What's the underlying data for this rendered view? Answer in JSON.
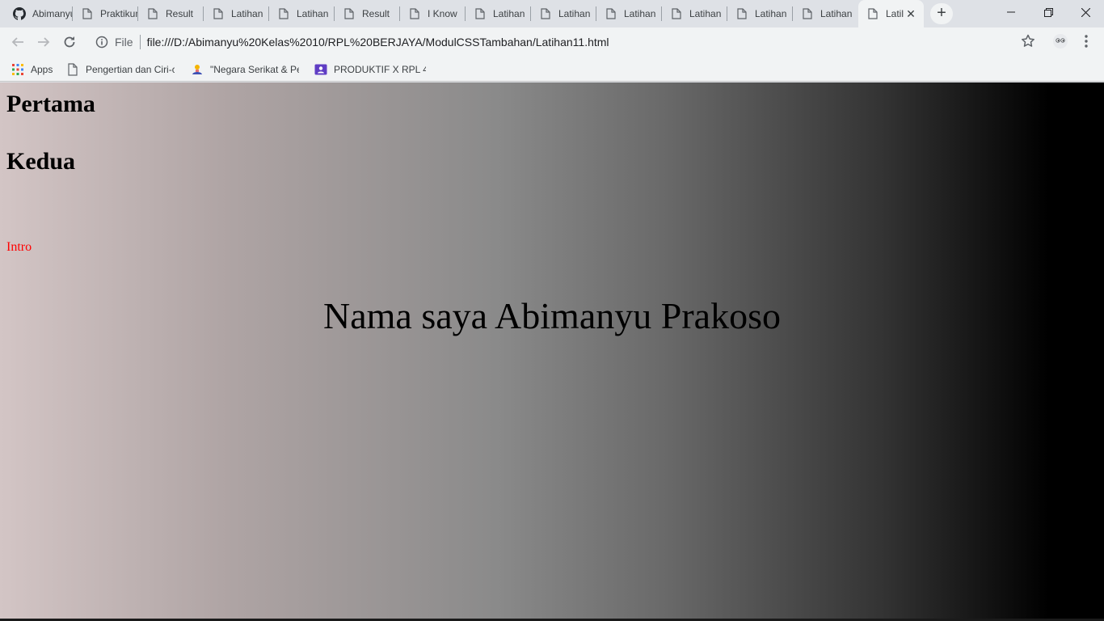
{
  "tabs": [
    {
      "label": "Abimanyu",
      "icon": "github-icon"
    },
    {
      "label": "Praktikum",
      "icon": "page-icon"
    },
    {
      "label": "Result",
      "icon": "page-icon"
    },
    {
      "label": "Latihan",
      "icon": "page-icon"
    },
    {
      "label": "Latihan",
      "icon": "page-icon"
    },
    {
      "label": "Result",
      "icon": "page-icon"
    },
    {
      "label": "I Know",
      "icon": "page-icon"
    },
    {
      "label": "Latihan",
      "icon": "page-icon"
    },
    {
      "label": "Latihan",
      "icon": "page-icon"
    },
    {
      "label": "Latihan",
      "icon": "page-icon"
    },
    {
      "label": "Latihan",
      "icon": "page-icon"
    },
    {
      "label": "Latihan",
      "icon": "page-icon"
    },
    {
      "label": "Latihan",
      "icon": "page-icon"
    },
    {
      "label": "Latil",
      "icon": "page-icon",
      "active": true
    }
  ],
  "tab_close": "✕",
  "new_tab": "+",
  "address": {
    "scheme": "File",
    "url": "file:///D:/Abimanyu%20Kelas%2010/RPL%20BERJAYA/ModulCSSTambahan/Latihan11.html"
  },
  "bookmarks": [
    {
      "label": "Apps",
      "icon": "apps-grid-icon"
    },
    {
      "label": "Pengertian dan Ciri-ci",
      "icon": "page-icon"
    },
    {
      "label": "\"Negara Serikat & Pe",
      "icon": "site-favicon-icon"
    },
    {
      "label": "PRODUKTIF X RPL 4 -",
      "icon": "classroom-icon"
    }
  ],
  "page": {
    "heading1": "Pertama",
    "heading2": "Kedua",
    "intro": "Intro",
    "name": "Nama saya Abimanyu Prakoso"
  }
}
